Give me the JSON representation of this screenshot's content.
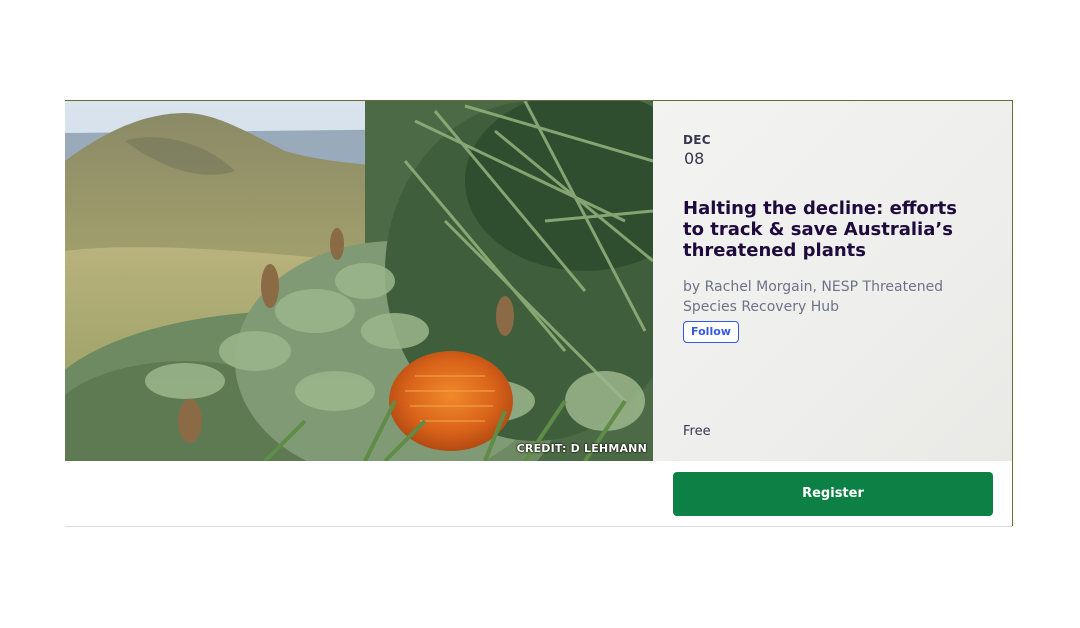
{
  "event": {
    "month": "DEC",
    "day": "08",
    "title": "Halting the decline: efforts to track & save Australia’s threatened plants",
    "organizer": "by Rachel Morgain, NESP Threatened Species Recovery Hub",
    "follow_label": "Follow",
    "price": "Free",
    "register_label": "Register",
    "image_credit": "CREDIT: D LEHMANN"
  },
  "colors": {
    "register_bg": "#0d8145",
    "follow_accent": "#3659e3",
    "title_text": "#1e0a3c"
  }
}
